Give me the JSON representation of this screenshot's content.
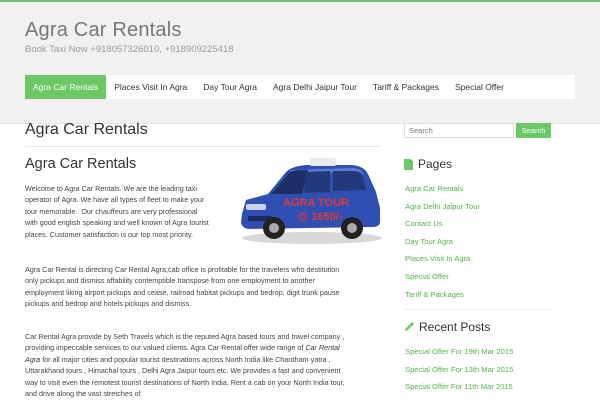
{
  "site": {
    "title": "Agra Car Rentals",
    "description": "Book Taxi Now +918057326010, +918909225418"
  },
  "nav": {
    "items": [
      {
        "label": "Agra Car Rentals",
        "active": true
      },
      {
        "label": "Places Visit In Agra",
        "active": false
      },
      {
        "label": "Day Tour Agra",
        "active": false
      },
      {
        "label": "Agra Delhi Jaipur Tour",
        "active": false
      },
      {
        "label": "Tariff & Packages",
        "active": false
      },
      {
        "label": "Special Offer",
        "active": false
      }
    ]
  },
  "page": {
    "title": "Agra Car Rentals",
    "heading": "Agra Car Rentals",
    "image_text": [
      "AGRA TOUR",
      "@ 1650/-"
    ],
    "para1": "Welcome to Agra Car Rentals. We are the leading taxi operator of Agra. We have all types of fleet to make your tour memorable . Our chauffeurs are very professional with good english speaking and well known of Agra tourist places. Customer satisfaction is our top most priority.",
    "para2": "Agra Car Rental  is directing Car Rental Agra,cab office is profitable for the travelers who destitution only pickups and dismiss affability contemptible transpose from one employment to another employment liking airport pickups and cease, railroad habitat pickups and bedrop, digit trunk pause pickups and bedrop and hotels pickups and dismiss.",
    "para3_before": "Car Rental Agra provide by Seth Travels which is the reputed Agra based tours and travel company , providing impeccable services to our valued clients. Agra Car Rental offer wide range of ",
    "para3_link": " Car Rental Agra ",
    "para3_after": " for all major cities and popular tourist destinations across North India like Chardham yatra , Uttarakhand tours , Himachal tours , Delhi Agra Jaipur tours etc. We provides a fast and convenient way to visit even the remotest tourist destinations of North  India. Rent a cab on your North India tour, and drive along the vast stretches of"
  },
  "sidebar": {
    "search": {
      "placeholder": "Search",
      "button": "Search"
    },
    "pages": {
      "title": "Pages",
      "items": [
        "Agra Car Rentals",
        "Agra Delhi Jaipur Tour",
        "Contact Us",
        "Day Tour Agra",
        "Places Visit In Agra",
        "Special Offer",
        "Tariff & Packages"
      ]
    },
    "recent": {
      "title": "Recent Posts",
      "items": [
        "Special Offer For 19th Mar 2015",
        "Special Offer For 13th Mar 2015",
        "Special Offer For 11th Mar 2015"
      ]
    }
  },
  "colors": {
    "accent": "#6cc765",
    "link": "#55b24c",
    "header_bg": "#f1f1f1"
  }
}
